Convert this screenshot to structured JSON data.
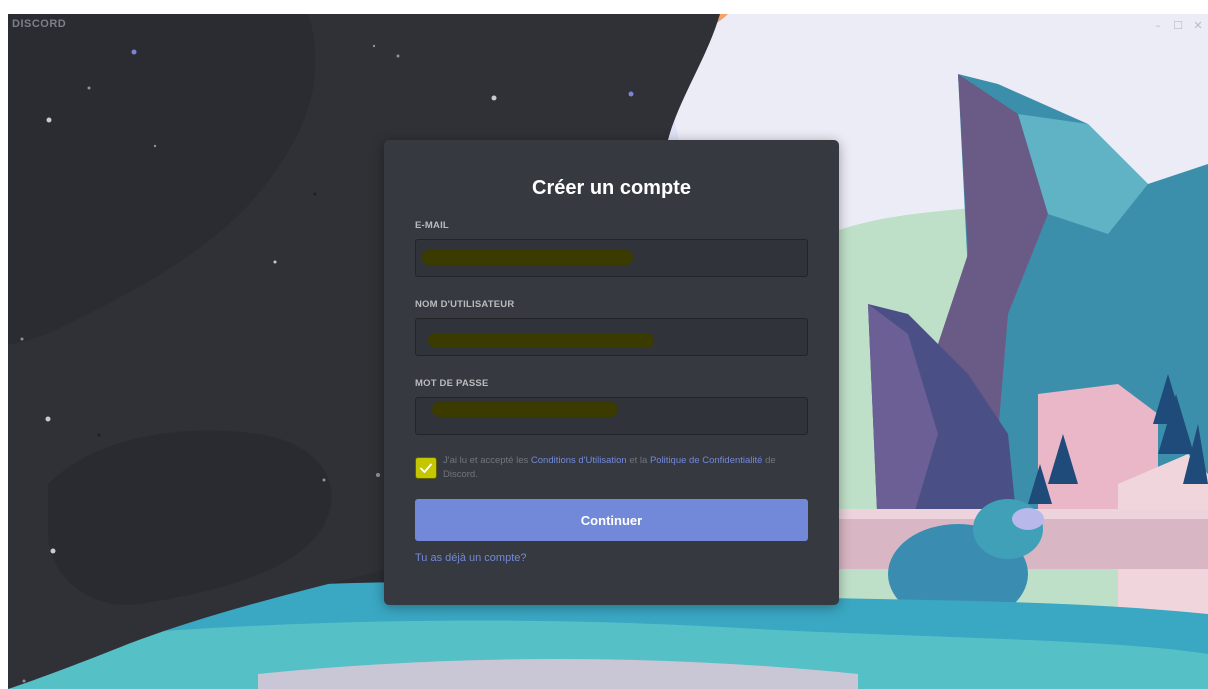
{
  "app": {
    "logo_text": "DISCORD"
  },
  "window_controls": {
    "minimize": "–",
    "maximize": "☐",
    "close": "✕"
  },
  "register": {
    "title": "Créer un compte",
    "email_label": "E-MAIL",
    "username_label": "NOM D'UTILISATEUR",
    "password_label": "MOT DE PASSE",
    "consent": {
      "checked": true,
      "text_before": "J'ai lu et accepté les ",
      "terms_link": "Conditions d'Utilisation",
      "text_middle": " et la ",
      "privacy_link": "Politique de Confidentialité",
      "text_after": " de Discord."
    },
    "continue_button": "Continuer",
    "login_link": "Tu as déjà un compte?"
  },
  "colors": {
    "card_bg": "#36393f",
    "input_bg": "#303339",
    "accent": "#7289da",
    "checkbox": "#c4c600",
    "redaction": "#3b3b00"
  }
}
